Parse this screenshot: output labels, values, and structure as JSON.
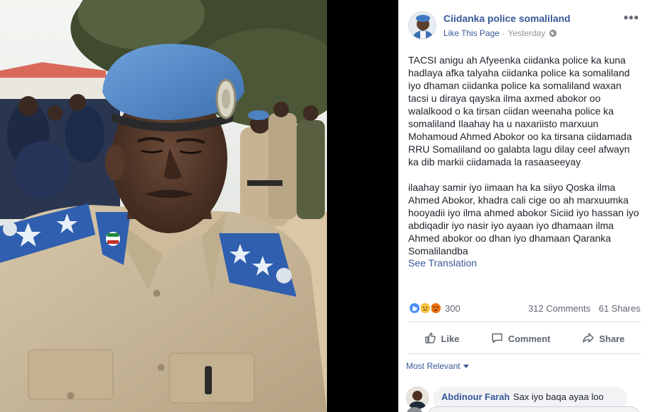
{
  "post": {
    "page_name": "Ciidanka police somaliland",
    "like_page": "Like This Page",
    "separator": "·",
    "timestamp": "Yesterday",
    "more": "•••",
    "paragraphs": [
      "TACSI anigu ah Afyeenka ciidanka police ka kuna hadlaya afka talyaha ciidanka police ka somaliland iyo dhaman ciidanka police ka somaliland waxan tacsi u diraya qayska ilma axmed abokor oo walalkood o ka tirsan ciidan weenaha police ka somaliland Ilaahay ha u naxariisto marxuun Mohamoud Ahmed Abokor oo ka tirsana ciidamada RRU Somaliland oo galabta lagu dilay ceel afwayn ka dib markii ciidamada la rasaaseeyay",
      "ilaahay samir iyo iimaan ha ka siiyo Qoska ilma Ahmed Abokor, khadra cali cige oo ah marxuumka hooyadii iyo ilma ahmed abokor Siciid iyo hassan iyo abdiqadir iyo nasir iyo ayaan iyo dhamaan ilma Ahmed abokor oo dhan iyo dhamaan Qaranka Somalilandba"
    ],
    "see_translation": "See Translation",
    "reaction_count": "300",
    "comments": "312 Comments",
    "shares": "61 Shares"
  },
  "actions": {
    "like": "Like",
    "comment": "Comment",
    "share": "Share"
  },
  "comments_section": {
    "sort_label": "Most Relevant",
    "first_comment": {
      "author": "Abdinour Farah",
      "text": "Sax iyo baqa ayaa loo"
    }
  },
  "colors": {
    "link_blue": "#385898",
    "like_blue": "#4a8df8",
    "sad_yellow": "#f7c33e",
    "angry_orange": "#e9710f",
    "beret_blue": "#4f86c6",
    "uniform_khaki": "#c9b79a"
  },
  "icons": [
    "globe-icon",
    "more-options-icon",
    "like-reaction-icon",
    "sad-reaction-icon",
    "angry-reaction-icon",
    "thumbs-up-icon",
    "comment-icon",
    "share-icon",
    "caret-down-icon"
  ]
}
